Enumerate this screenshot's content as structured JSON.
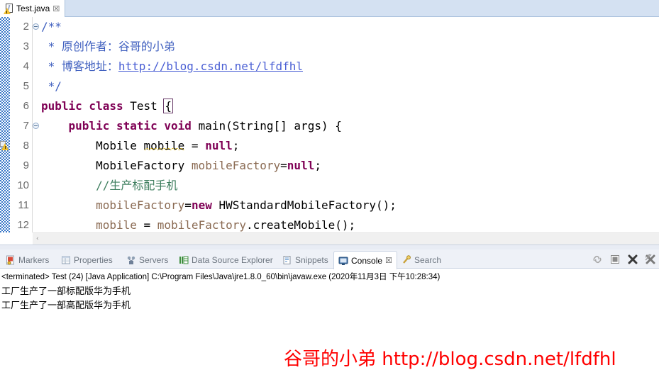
{
  "editor": {
    "tab": {
      "label": "Test.java",
      "icon": "java-file-warning-icon",
      "close": "☒"
    },
    "lines": [
      {
        "num": "2",
        "fold": true,
        "marker": "",
        "segments": [
          {
            "text": "/**",
            "style": "jdoc"
          }
        ],
        "plain": "/**"
      },
      {
        "num": "3",
        "fold": false,
        "marker": "",
        "segments": [
          {
            "text": " * 原创作者：谷哥的小弟",
            "style": "jdoc"
          }
        ],
        "plain": " * 原创作者：谷哥的小弟"
      },
      {
        "num": "4",
        "fold": false,
        "marker": "",
        "segments": [
          {
            "text": " * 博客地址：",
            "style": "jdoc"
          },
          {
            "text": "http://blog.csdn.net/lfdfhl",
            "style": "jdoc-link"
          }
        ],
        "plain": " * 博客地址：http://blog.csdn.net/lfdfhl"
      },
      {
        "num": "5",
        "fold": false,
        "marker": "",
        "segments": [
          {
            "text": " */",
            "style": "jdoc"
          }
        ],
        "plain": " */"
      },
      {
        "num": "6",
        "fold": false,
        "marker": "",
        "segments": [
          {
            "text": "public class ",
            "style": "kw"
          },
          {
            "text": "Test ",
            "style": "plain"
          },
          {
            "text": "{",
            "style": "brkbox"
          }
        ],
        "plain": "public class Test {"
      },
      {
        "num": "7",
        "fold": true,
        "marker": "",
        "segments": [
          {
            "text": "    ",
            "style": "plain"
          },
          {
            "text": "public static void ",
            "style": "kw"
          },
          {
            "text": "main(String[] args) {",
            "style": "plain"
          }
        ],
        "plain": "    public static void main(String[] args) {"
      },
      {
        "num": "8",
        "fold": false,
        "marker": "warning",
        "segments": [
          {
            "text": "        Mobile ",
            "style": "plain"
          },
          {
            "text": "mobile",
            "style": "squig"
          },
          {
            "text": " = ",
            "style": "plain"
          },
          {
            "text": "null",
            "style": "kw"
          },
          {
            "text": ";",
            "style": "plain"
          }
        ],
        "plain": "        Mobile mobile = null;"
      },
      {
        "num": "9",
        "fold": false,
        "marker": "",
        "segments": [
          {
            "text": "        MobileFactory ",
            "style": "plain"
          },
          {
            "text": "mobileFactory",
            "style": "fld"
          },
          {
            "text": "=",
            "style": "plain"
          },
          {
            "text": "null",
            "style": "kw"
          },
          {
            "text": ";",
            "style": "plain"
          }
        ],
        "plain": "        MobileFactory mobileFactory=null;"
      },
      {
        "num": "10",
        "fold": false,
        "marker": "",
        "segments": [
          {
            "text": "        //生产标配手机",
            "style": "cmt"
          }
        ],
        "plain": "        //生产标配手机"
      },
      {
        "num": "11",
        "fold": false,
        "marker": "",
        "segments": [
          {
            "text": "        ",
            "style": "plain"
          },
          {
            "text": "mobileFactory",
            "style": "fld"
          },
          {
            "text": "=",
            "style": "plain"
          },
          {
            "text": "new",
            "style": "kw"
          },
          {
            "text": " HWStandardMobileFactory();",
            "style": "plain"
          }
        ],
        "plain": "        mobileFactory=new HWStandardMobileFactory();"
      },
      {
        "num": "12",
        "fold": false,
        "marker": "",
        "segments": [
          {
            "text": "        ",
            "style": "plain"
          },
          {
            "text": "mobile",
            "style": "fld"
          },
          {
            "text": " = ",
            "style": "plain"
          },
          {
            "text": "mobileFactory",
            "style": "fld"
          },
          {
            "text": ".createMobile();",
            "style": "plain"
          }
        ],
        "plain": "        mobile = mobileFactory.createMobile();"
      }
    ],
    "scrollbar": {
      "left_arrow": "‹"
    }
  },
  "bottom_panel": {
    "tabs": [
      {
        "label": "Markers",
        "icon": "markers-icon",
        "active": false
      },
      {
        "label": "Properties",
        "icon": "properties-icon",
        "active": false
      },
      {
        "label": "Servers",
        "icon": "servers-icon",
        "active": false
      },
      {
        "label": "Data Source Explorer",
        "icon": "data-source-explorer-icon",
        "active": false
      },
      {
        "label": "Snippets",
        "icon": "snippets-icon",
        "active": false
      },
      {
        "label": "Console",
        "icon": "console-icon",
        "active": true,
        "close": "☒"
      },
      {
        "label": "Search",
        "icon": "search-icon",
        "active": false
      }
    ],
    "toolbar": [
      {
        "name": "pin-console-icon"
      },
      {
        "name": "terminate-icon"
      },
      {
        "name": "remove-launch-icon"
      },
      {
        "name": "remove-all-terminated-icon"
      }
    ],
    "console": {
      "status_line": "<terminated> Test (24) [Java Application] C:\\Program Files\\Java\\jre1.8.0_60\\bin\\javaw.exe (2020年11月3日 下午10:28:34)",
      "output": [
        "工厂生产了一部标配版华为手机",
        "工厂生产了一部高配版华为手机"
      ]
    }
  },
  "watermark": {
    "text": "谷哥的小弟 http://blog.csdn.net/lfdfhl",
    "color": "#ff0000"
  },
  "colors": {
    "keyword": "#7f0055",
    "javadoc": "#3f5fbf",
    "comment": "#3f7f5f",
    "field": "#8a6a52",
    "tabbar": "#d4e1f2",
    "annotation_ruler": "#3a78c8"
  }
}
